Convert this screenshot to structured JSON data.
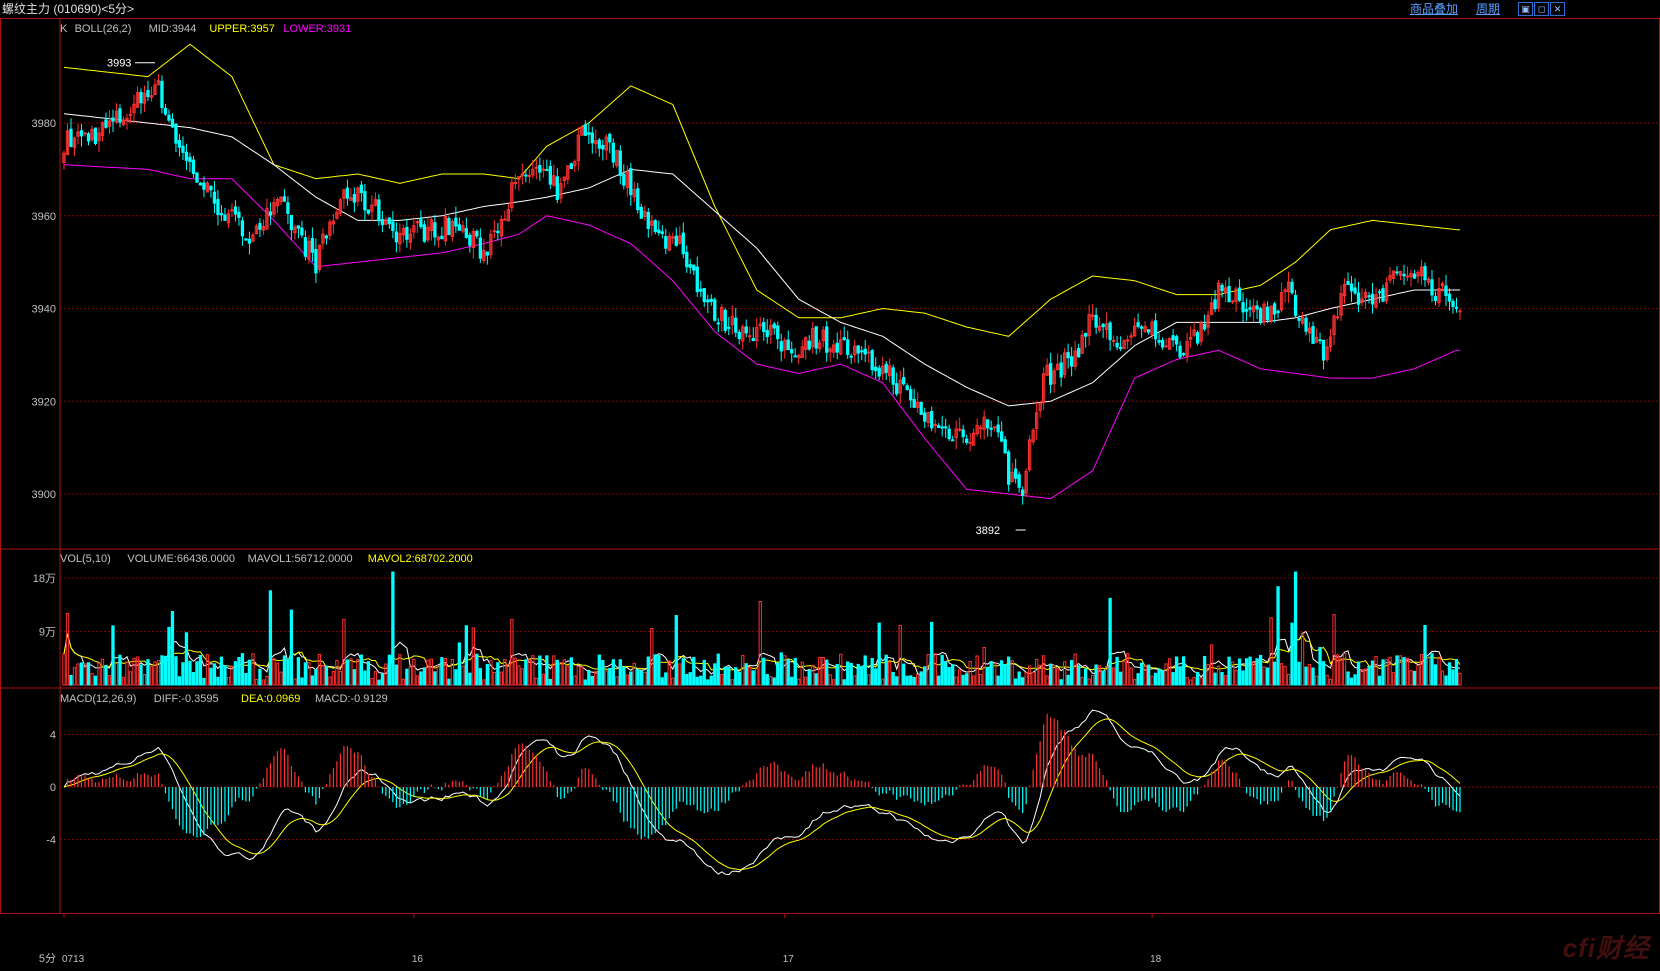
{
  "window": {
    "title": "螺纹主力 (010690)<5分>",
    "overlay_button": "商品叠加",
    "cycle_button": "周期",
    "win_icons": [
      "restore-icon",
      "maximize-icon",
      "close-icon"
    ]
  },
  "colors": {
    "up": "#ff3030",
    "down": "#00ffff",
    "mid": "#ffffff",
    "upper": "#ffff00",
    "lower": "#ff00ff",
    "grid": "#8b0000",
    "frame": "#b01010",
    "axis_text": "#c0c0c0"
  },
  "panels": {
    "price": {
      "header": [
        "K",
        "BOLL(26,2)",
        "MID:3944",
        "UPPER:3957",
        "LOWER:3931"
      ],
      "y_ticks": [
        "3980",
        "3960",
        "3940",
        "3920",
        "3900"
      ],
      "high_marker": "3993",
      "low_marker": "3892"
    },
    "volume": {
      "header": [
        "VOL(5,10)",
        "VOLUME:66436.0000",
        "MAVOL1:56712.0000",
        "MAVOL2:68702.2000"
      ],
      "y_ticks": [
        "18万",
        "9万"
      ]
    },
    "macd": {
      "header": [
        "MACD(12,26,9)",
        "DIFF:-0.3595",
        "DEA:0.0969",
        "MACD:-0.9129"
      ],
      "y_ticks": [
        "4",
        "0",
        "-4"
      ]
    }
  },
  "x_axis": {
    "period_label": "5分",
    "labels": [
      "0713",
      "16",
      "17",
      "18"
    ]
  },
  "chart_data": {
    "type": "candlestick",
    "title": "螺纹主力 (010690)<5分>",
    "ylim": [
      3882,
      4000
    ],
    "volume_ylim": [
      0,
      200000
    ],
    "macd_ylim": [
      -8,
      5.5
    ],
    "boll_upper": [
      [
        0,
        3992
      ],
      [
        24,
        3990
      ],
      [
        36,
        3997
      ],
      [
        48,
        3990
      ],
      [
        60,
        3971
      ],
      [
        72,
        3968
      ],
      [
        84,
        3969
      ],
      [
        96,
        3967
      ],
      [
        108,
        3969
      ],
      [
        120,
        3969
      ],
      [
        130,
        3968
      ],
      [
        138,
        3975
      ],
      [
        150,
        3980
      ],
      [
        162,
        3988
      ],
      [
        174,
        3984
      ],
      [
        186,
        3962
      ],
      [
        198,
        3944
      ],
      [
        210,
        3938
      ],
      [
        222,
        3938
      ],
      [
        234,
        3940
      ],
      [
        246,
        3939
      ],
      [
        258,
        3936
      ],
      [
        270,
        3934
      ],
      [
        282,
        3942
      ],
      [
        294,
        3947
      ],
      [
        306,
        3946
      ],
      [
        318,
        3943
      ],
      [
        330,
        3943
      ],
      [
        342,
        3945
      ],
      [
        352,
        3950
      ],
      [
        362,
        3957
      ],
      [
        374,
        3959
      ],
      [
        386,
        3958
      ],
      [
        398,
        3957
      ]
    ],
    "boll_mid": [
      [
        0,
        3982
      ],
      [
        24,
        3980
      ],
      [
        36,
        3979
      ],
      [
        48,
        3977
      ],
      [
        60,
        3971
      ],
      [
        72,
        3964
      ],
      [
        84,
        3959
      ],
      [
        96,
        3959
      ],
      [
        108,
        3960
      ],
      [
        120,
        3962
      ],
      [
        130,
        3963
      ],
      [
        138,
        3964
      ],
      [
        150,
        3966
      ],
      [
        162,
        3970
      ],
      [
        174,
        3969
      ],
      [
        186,
        3961
      ],
      [
        198,
        3953
      ],
      [
        210,
        3942
      ],
      [
        222,
        3937
      ],
      [
        234,
        3934
      ],
      [
        246,
        3928
      ],
      [
        258,
        3923
      ],
      [
        270,
        3919
      ],
      [
        282,
        3920
      ],
      [
        294,
        3924
      ],
      [
        306,
        3932
      ],
      [
        318,
        3937
      ],
      [
        330,
        3937
      ],
      [
        342,
        3937
      ],
      [
        352,
        3938
      ],
      [
        362,
        3940
      ],
      [
        374,
        3942
      ],
      [
        386,
        3944
      ],
      [
        398,
        3944
      ]
    ],
    "boll_lower": [
      [
        0,
        3971
      ],
      [
        24,
        3970
      ],
      [
        36,
        3968
      ],
      [
        48,
        3968
      ],
      [
        60,
        3959
      ],
      [
        72,
        3949
      ],
      [
        84,
        3950
      ],
      [
        96,
        3951
      ],
      [
        108,
        3952
      ],
      [
        120,
        3954
      ],
      [
        130,
        3956
      ],
      [
        138,
        3960
      ],
      [
        150,
        3958
      ],
      [
        162,
        3954
      ],
      [
        174,
        3946
      ],
      [
        186,
        3935
      ],
      [
        198,
        3928
      ],
      [
        210,
        3926
      ],
      [
        222,
        3928
      ],
      [
        234,
        3924
      ],
      [
        246,
        3912
      ],
      [
        258,
        3901
      ],
      [
        270,
        3900
      ],
      [
        282,
        3899
      ],
      [
        294,
        3905
      ],
      [
        306,
        3925
      ],
      [
        318,
        3929
      ],
      [
        330,
        3931
      ],
      [
        342,
        3927
      ],
      [
        352,
        3926
      ],
      [
        362,
        3925
      ],
      [
        374,
        3925
      ],
      [
        386,
        3927
      ],
      [
        398,
        3931
      ]
    ],
    "price_path": [
      [
        0,
        3976
      ],
      [
        10,
        3978
      ],
      [
        18,
        3982
      ],
      [
        26,
        3989
      ],
      [
        34,
        3973
      ],
      [
        42,
        3964
      ],
      [
        52,
        3956
      ],
      [
        62,
        3962
      ],
      [
        72,
        3950
      ],
      [
        80,
        3965
      ],
      [
        88,
        3962
      ],
      [
        96,
        3956
      ],
      [
        104,
        3957
      ],
      [
        112,
        3958
      ],
      [
        120,
        3952
      ],
      [
        128,
        3965
      ],
      [
        134,
        3970
      ],
      [
        142,
        3965
      ],
      [
        148,
        3978
      ],
      [
        156,
        3975
      ],
      [
        162,
        3966
      ],
      [
        170,
        3955
      ],
      [
        176,
        3955
      ],
      [
        184,
        3940
      ],
      [
        192,
        3936
      ],
      [
        200,
        3935
      ],
      [
        208,
        3931
      ],
      [
        214,
        3934
      ],
      [
        222,
        3932
      ],
      [
        228,
        3929
      ],
      [
        236,
        3926
      ],
      [
        242,
        3920
      ],
      [
        250,
        3914
      ],
      [
        258,
        3913
      ],
      [
        266,
        3916
      ],
      [
        270,
        3904
      ],
      [
        274,
        3902
      ],
      [
        280,
        3925
      ],
      [
        288,
        3929
      ],
      [
        294,
        3938
      ],
      [
        302,
        3932
      ],
      [
        310,
        3936
      ],
      [
        318,
        3931
      ],
      [
        324,
        3935
      ],
      [
        330,
        3943
      ],
      [
        338,
        3941
      ],
      [
        344,
        3939
      ],
      [
        350,
        3944
      ],
      [
        356,
        3935
      ],
      [
        360,
        3930
      ],
      [
        366,
        3943
      ],
      [
        374,
        3942
      ],
      [
        380,
        3946
      ],
      [
        386,
        3949
      ],
      [
        392,
        3944
      ],
      [
        398,
        3941
      ]
    ],
    "volume_mavol1_level": 45000,
    "volume_mavol2_level": 40000,
    "last": {
      "close": 3941,
      "volume": 66436,
      "diff": -0.3595,
      "dea": 0.0969,
      "macd": -0.9129
    }
  }
}
